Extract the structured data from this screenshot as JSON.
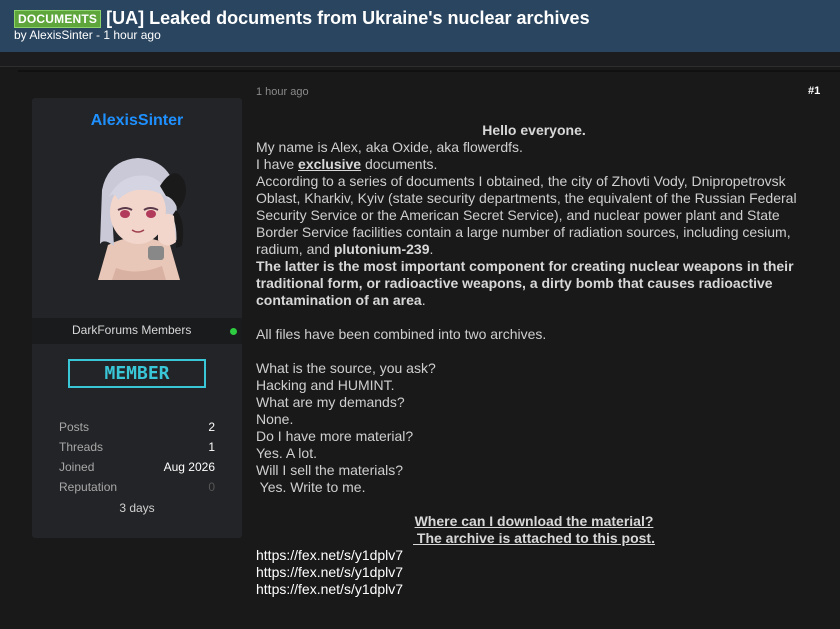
{
  "thread": {
    "prefix": "DOCUMENTS",
    "title": "[UA] Leaked documents from Ukraine's nuclear archives",
    "meta": "by AlexisSinter - 1 hour ago"
  },
  "user": {
    "name": "AlexisSinter",
    "group": "DarkForums Members",
    "badge": "MEMBER",
    "stats": [
      {
        "label": "Posts",
        "value": "2"
      },
      {
        "label": "Threads",
        "value": "1"
      },
      {
        "label": "Joined",
        "value": "Aug 2026"
      },
      {
        "label": "Reputation",
        "value": "0"
      }
    ],
    "time_online": "3 days"
  },
  "post": {
    "time": "1 hour ago",
    "number": "#1",
    "greeting": "Hello everyone.",
    "line1": "My name is Alex, aka Oxide, aka flowerdfs.",
    "line2_pre": "I have ",
    "line2_bold": "exclusive",
    "line2_post": " documents.",
    "para_pre": "According to a series of documents I obtained, the city of Zhovti Vody, Dnipropetrovsk Oblast, Kharkiv, Kyiv (state security departments, the equivalent of the Russian Federal Security Service or the American Secret Service), and nuclear power plant and State Border Service facilities contain a large number of radiation sources, including cesium, radium, and ",
    "para_bold": "plutonium-239",
    "para_post": ".",
    "bold_para": "The latter is the most important component for creating nuclear weapons in their traditional form, or radioactive weapons, a dirty bomb that causes radioactive contamination of an area",
    "bold_para_end": ".",
    "archives": "All files have been combined into two archives.",
    "qa": [
      "What is the source, you ask?",
      "Hacking and HUMINT.",
      "What are my demands?",
      "None.",
      "Do I have more material?",
      "Yes. A lot.",
      "Will I sell the materials?",
      " Yes. Write to me."
    ],
    "download_q": "Where can I download the material?",
    "download_a": " The archive is attached to this post.",
    "links": [
      "https://fex.net/s/y1dplv7",
      "https://fex.net/s/y1dplv7",
      "https://fex.net/s/y1dplv7"
    ]
  }
}
